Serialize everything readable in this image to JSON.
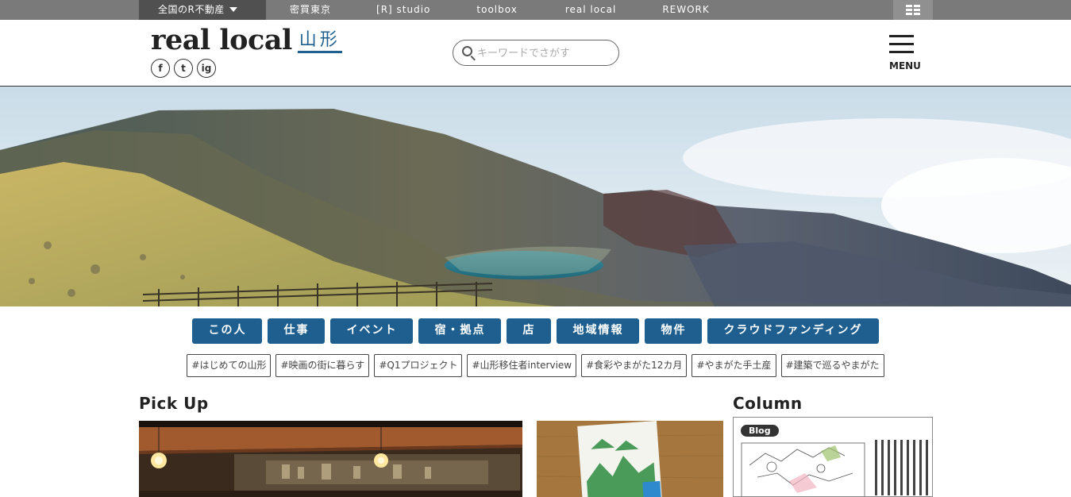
{
  "topbar": {
    "network_label": "全国のR不動産",
    "links": [
      "密買東京",
      "[R] studio",
      "toolbox",
      "real local",
      "REWORK"
    ]
  },
  "header": {
    "brand": "real local",
    "area": "山形",
    "social": [
      "f",
      "t",
      "ig"
    ],
    "search_placeholder": "キーワードでさがす",
    "menu_label": "MENU"
  },
  "categories": [
    "この人",
    "仕事",
    "イベント",
    "宿・拠点",
    "店",
    "地域情報",
    "物件",
    "クラウドファンディング"
  ],
  "tags": [
    "#はじめての山形",
    "#映画の街に暮らす",
    "#Q1プロジェクト",
    "#山形移住者interview",
    "#食彩やまがた12カ月",
    "#やまがた手土産",
    "#建築で巡るやまがた"
  ],
  "sections": {
    "pickup_title": "Pick Up",
    "column_title": "Column",
    "column_badge": "Blog"
  },
  "colors": {
    "accent": "#1f5f8f",
    "topbar": "#7a7a7a"
  }
}
